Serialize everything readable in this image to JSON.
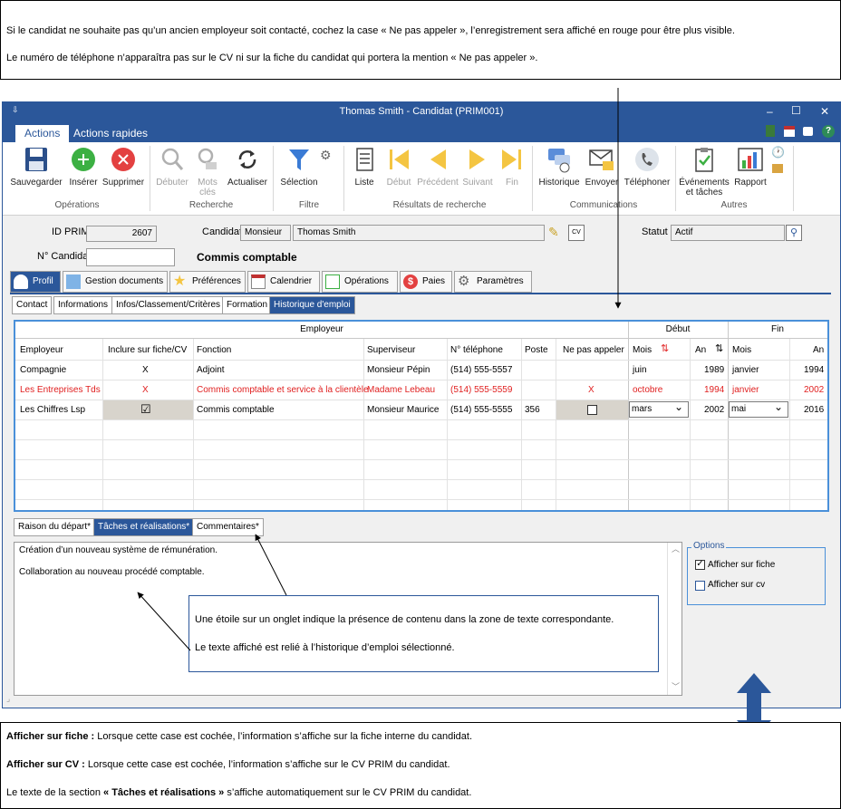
{
  "top_note": {
    "line1": "Si le candidat ne souhaite pas qu’un ancien employeur soit contacté, cochez la case « Ne pas appeler », l’enregistrement sera affiché en rouge pour être plus visible.",
    "line2": "Le numéro de téléphone n’apparaîtra pas sur le CV ni sur la fiche du candidat qui portera la mention « Ne pas appeler »."
  },
  "window": {
    "title": "Thomas Smith - Candidat (PRIM001)",
    "controls": [
      "–",
      "☐",
      "✕"
    ]
  },
  "ribbon_tabs": [
    "Actions",
    "Actions rapides"
  ],
  "ribbon": {
    "buttons": [
      {
        "label": "Sauvegarder"
      },
      {
        "label": "Insérer"
      },
      {
        "label": "Supprimer"
      },
      {
        "label": "Débuter"
      },
      {
        "label": "Mots clés"
      },
      {
        "label": "Actualiser"
      },
      {
        "label": "Sélection"
      },
      {
        "label": "Liste"
      },
      {
        "label": "Début"
      },
      {
        "label": "Précédent"
      },
      {
        "label": "Suivant"
      },
      {
        "label": "Fin"
      },
      {
        "label": "Historique"
      },
      {
        "label": "Envoyer"
      },
      {
        "label": "Téléphoner"
      },
      {
        "label": "Événements et tâches"
      },
      {
        "label": "Rapport"
      }
    ],
    "groups": [
      "Opérations",
      "Recherche",
      "Filtre",
      "Résultats de recherche",
      "Communications",
      "Autres"
    ]
  },
  "form": {
    "id_label": "ID PRIM",
    "id_value": "2607",
    "candidat_label": "Candidat",
    "salutation": "Monsieur",
    "name": "Thomas Smith",
    "statut_label": "Statut",
    "statut_value": "Actif",
    "no_label": "N° Candidat",
    "no_value": "",
    "job_title": "Commis comptable"
  },
  "profile_tabs": [
    "Profil",
    "Gestion documents",
    "Préférences",
    "Calendrier",
    "Opérations",
    "Paies",
    "Paramètres"
  ],
  "sub_tabs": [
    "Contact",
    "Informations",
    "Infos/Classement/Critères",
    "Formation",
    "Historique d'emploi"
  ],
  "grid": {
    "group_headers": [
      "Employeur",
      "Début",
      "Fin"
    ],
    "columns": [
      "Employeur",
      "Inclure sur fiche/CV",
      "Fonction",
      "Superviseur",
      "N° téléphone",
      "Poste",
      "Ne pas appeler",
      "Mois",
      "An",
      "Mois",
      "An"
    ],
    "rows": [
      {
        "employeur": "Compagnie",
        "inclure": "X",
        "fonction": "Adjoint",
        "superviseur": "Monsieur Pépin",
        "telephone": "(514) 555-5557",
        "poste": "",
        "ne_pas_appeler": "",
        "debut_mois": "juin",
        "debut_an": "1989",
        "fin_mois": "janvier",
        "fin_an": "1994",
        "red": false
      },
      {
        "employeur": "Les Entreprises Tds",
        "inclure": "X",
        "fonction": "Commis comptable et service à la clientèle",
        "superviseur": "Madame Lebeau",
        "telephone": "(514) 555-5559",
        "poste": "",
        "ne_pas_appeler": "X",
        "debut_mois": "octobre",
        "debut_an": "1994",
        "fin_mois": "janvier",
        "fin_an": "2002",
        "red": true
      },
      {
        "employeur": "Les Chiffres Lsp",
        "inclure": "☑",
        "fonction": "Commis comptable",
        "superviseur": "Monsieur Maurice",
        "telephone": "(514) 555-5555",
        "poste": "356",
        "ne_pas_appeler": "",
        "debut_mois": "mars",
        "debut_an": "2002",
        "fin_mois": "mai",
        "fin_an": "2016",
        "red": false
      }
    ]
  },
  "bottom_tabs": [
    "Raison du départ*",
    "Tâches et réalisations*",
    "Commentaires*"
  ],
  "text_content": {
    "line1": "Création d’un nouveau système de rémunération.",
    "line2": "Collaboration au nouveau procédé comptable."
  },
  "options": {
    "title": "Options",
    "afficher_fiche": "Afficher sur fiche",
    "afficher_fiche_checked": true,
    "afficher_cv": "Afficher sur cv",
    "afficher_cv_checked": false
  },
  "callout": {
    "line1": "Une étoile sur un onglet indique la présence de contenu dans la zone de texte correspondante.",
    "line2": "Le texte affiché est relié à l’historique d’emploi sélectionné."
  },
  "bottom_note": {
    "b1_label": "Afficher sur fiche :",
    "b1_text": " Lorsque cette case est cochée, l’information s’affiche sur la fiche interne du candidat.",
    "b2_label": "Afficher sur CV :",
    "b2_text": " Lorsque cette case est cochée, l’information s’affiche sur le CV PRIM du candidat.",
    "b3_pre": "Le texte de la section ",
    "b3_label": "« Tâches et réalisations »",
    "b3_post": " s’affiche automatiquement sur le CV PRIM du candidat."
  },
  "colors": {
    "accent": "#2b579a",
    "red_text": "#e02020",
    "grid_border": "#4a90d9",
    "arrow": "#2b579a"
  }
}
